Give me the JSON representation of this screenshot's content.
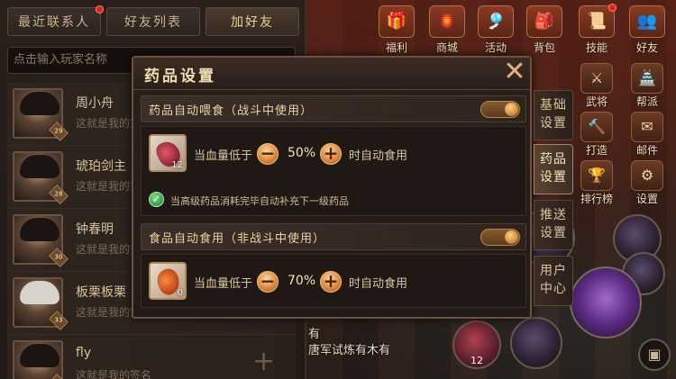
{
  "friends": {
    "tabs": [
      {
        "label": "最近联系人"
      },
      {
        "label": "好友列表"
      },
      {
        "label": "加好友"
      }
    ],
    "search_placeholder": "点击输入玩家名称",
    "rows": [
      {
        "name": "周小舟",
        "sign": "这就是我的签名",
        "level": "29"
      },
      {
        "name": "琥珀剑主",
        "sign": "这就是我的签名",
        "level": "28"
      },
      {
        "name": "钟春明",
        "sign": "这就是我的签名",
        "level": "30"
      },
      {
        "name": "板栗板栗",
        "sign": "这就是我的签名",
        "level": "33"
      },
      {
        "name": "fly",
        "sign": "这就是我的签名",
        "level": "26"
      }
    ],
    "add_icon": "plus-icon"
  },
  "top_icons": [
    {
      "label": "福利",
      "icon": "gift-icon",
      "glyph": "🎁"
    },
    {
      "label": "商城",
      "icon": "shop-icon",
      "glyph": "🏮"
    },
    {
      "label": "活动",
      "icon": "event-icon",
      "glyph": "🎐"
    },
    {
      "label": "背包",
      "icon": "bag-icon",
      "glyph": "🎒"
    },
    {
      "label": "技能",
      "icon": "skill-book-icon",
      "glyph": "📜"
    },
    {
      "label": "好友",
      "icon": "friends-icon",
      "glyph": "👥"
    }
  ],
  "side_icons": [
    {
      "label": "武将",
      "icon": "general-icon",
      "glyph": "⚔"
    },
    {
      "label": "帮派",
      "icon": "guild-icon",
      "glyph": "🏯"
    },
    {
      "label": "打造",
      "icon": "forge-icon",
      "glyph": "🔨"
    },
    {
      "label": "邮件",
      "icon": "mail-icon",
      "glyph": "✉"
    },
    {
      "label": "排行榜",
      "icon": "ranking-icon",
      "glyph": "🏆"
    },
    {
      "label": "设置",
      "icon": "settings-gear-icon",
      "glyph": "⚙"
    }
  ],
  "modal": {
    "title": "药品设置",
    "close_glyph": "✕",
    "battle": {
      "title": "药品自动喂食（战斗中使用）",
      "enabled": true,
      "item_count": "12",
      "hp_label": "当血量低于",
      "minus": "−",
      "percent": "50%",
      "plus": "+",
      "suffix": "时自动食用",
      "auto_refill_text": "当高级药品消耗完毕自动补充下一级药品",
      "auto_refill_checked": true
    },
    "food": {
      "title": "食品自动食用（非战斗中使用）",
      "enabled": true,
      "item_count": "0",
      "hp_label": "当血量低于",
      "minus": "−",
      "percent": "70%",
      "plus": "+",
      "suffix": "时自动食用"
    }
  },
  "side_tabs": [
    {
      "label": "基础设置",
      "active": false
    },
    {
      "label": "药品设置",
      "active": true
    },
    {
      "label": "推送设置",
      "active": false
    },
    {
      "label": "用户中心",
      "active": false
    }
  ],
  "bottom": {
    "line1": "有",
    "line2": "唐军试炼有木有",
    "potion_count": "12"
  },
  "colors": {
    "accent_orange": "#dd8a3e",
    "panel_bg": "#2b211c",
    "text_gold": "#f0dfb2",
    "notify_red": "#d9261c"
  }
}
